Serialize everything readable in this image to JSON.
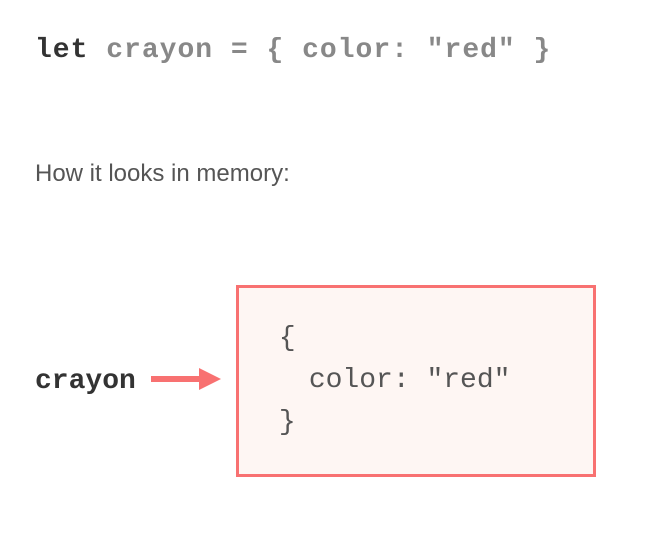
{
  "code": {
    "keyword": "let",
    "variable": "crayon",
    "equals": "=",
    "object": "{ color: \"red\" }"
  },
  "caption": "How it looks in memory:",
  "memory": {
    "label": "crayon",
    "openBrace": "{",
    "content": "color: \"red\"",
    "closeBrace": "}"
  },
  "colors": {
    "arrow": "#f87171",
    "boxBorder": "#f87171",
    "boxBg": "#fef6f3"
  }
}
